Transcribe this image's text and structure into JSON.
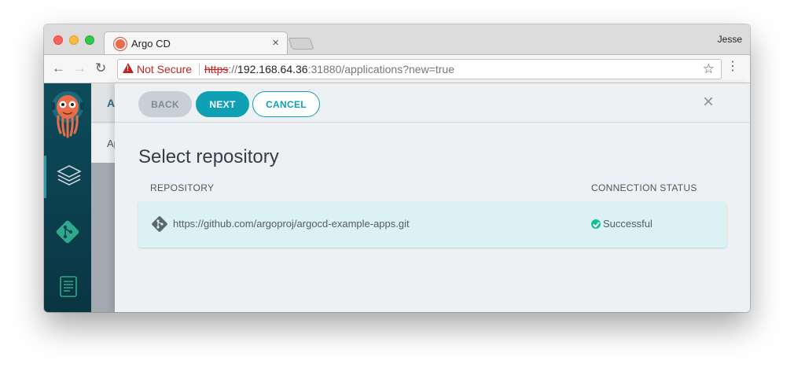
{
  "browser": {
    "tab_title": "Argo CD",
    "tab_close": "×",
    "profile_name": "Jesse",
    "security_label": "Not Secure",
    "url_scheme": "https",
    "url_sep": "://",
    "url_host": "192.168.64.36",
    "url_rest": ":31880/applications?new=true"
  },
  "background_page": {
    "header_letter": "A",
    "row_letter": "Ap"
  },
  "panel": {
    "back_label": "BACK",
    "next_label": "NEXT",
    "cancel_label": "CANCEL",
    "close_glyph": "×",
    "title": "Select repository",
    "columns": {
      "repository": "REPOSITORY",
      "status": "CONNECTION STATUS"
    },
    "repositories": [
      {
        "url": "https://github.com/argoproj/argocd-example-apps.git",
        "status": "Successful"
      }
    ]
  },
  "colors": {
    "accent": "#0fa0b4",
    "sidebar": "#0d4c5c",
    "success": "#18be94",
    "row_highlight": "#dbf1f4"
  },
  "icons": {
    "sidebar": [
      "argo-logo-icon",
      "layers-icon",
      "git-icon",
      "docs-icon"
    ],
    "row": [
      "git-repo-icon",
      "check-circle-icon"
    ]
  }
}
